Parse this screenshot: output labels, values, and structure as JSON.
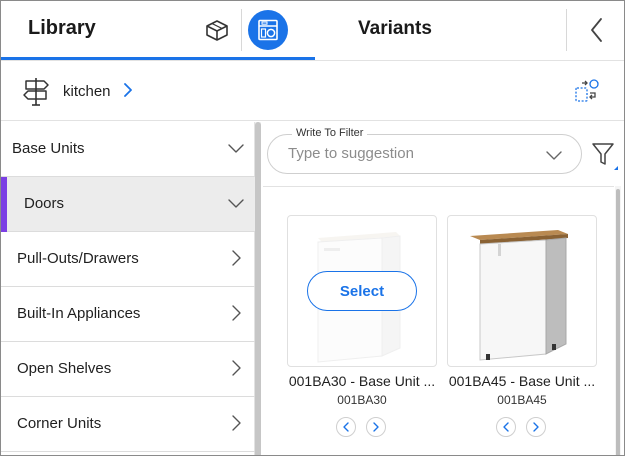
{
  "header": {
    "library_tab": "Library",
    "variants_tab": "Variants",
    "accent_color": "#1a73e8"
  },
  "breadcrumb": {
    "label": "kitchen"
  },
  "sidebar": {
    "items": [
      {
        "label": "Base Units",
        "state": "expanded"
      },
      {
        "label": "Doors",
        "state": "expanded"
      },
      {
        "label": "Pull-Outs/Drawers",
        "state": "collapsed"
      },
      {
        "label": "Built-In Appliances",
        "state": "collapsed"
      },
      {
        "label": "Open Shelves",
        "state": "collapsed"
      },
      {
        "label": "Corner Units",
        "state": "collapsed"
      }
    ],
    "active_accent": "#7b3fe4"
  },
  "filter": {
    "legend": "Write To Filter",
    "placeholder": "Type to suggestion"
  },
  "products": [
    {
      "title": "001BA30 - Base Unit ...",
      "code": "001BA30",
      "action": "Select",
      "icon": "base-unit-white"
    },
    {
      "title": "001BA45 - Base Unit ...",
      "code": "001BA45",
      "icon": "base-unit-wood-top"
    }
  ]
}
